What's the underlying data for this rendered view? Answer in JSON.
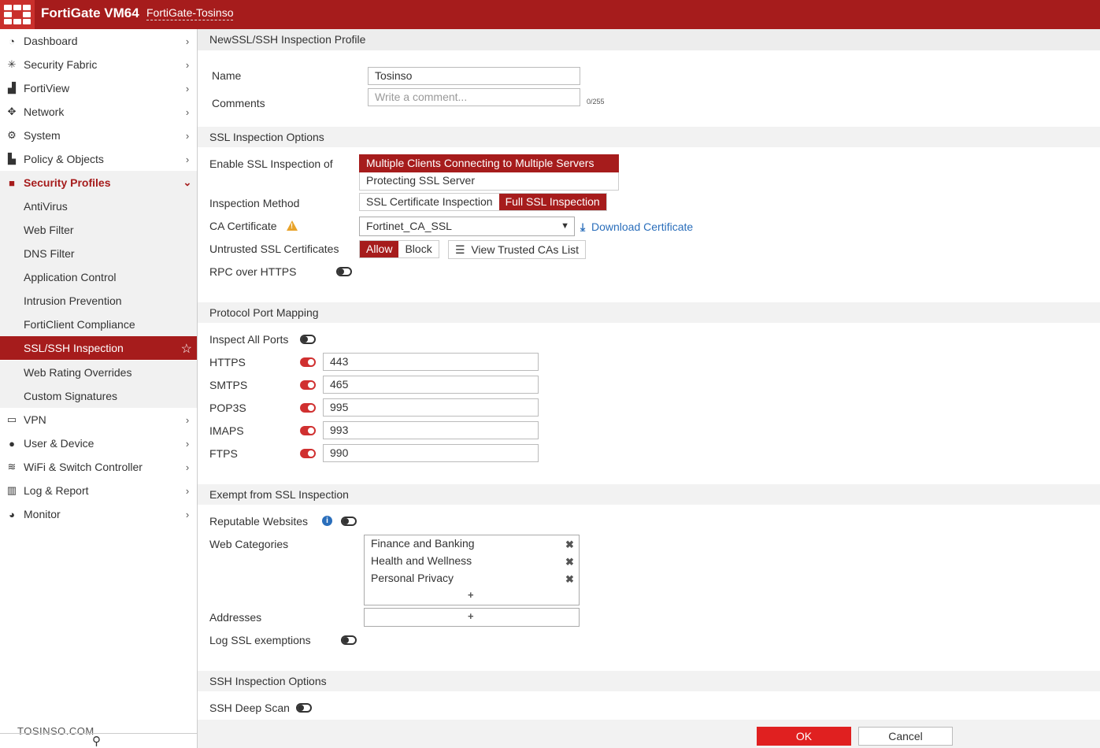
{
  "header": {
    "product": "FortiGate VM64",
    "hostname": "FortiGate-Tosinso"
  },
  "sidebar": {
    "items": [
      {
        "label": "Dashboard",
        "icon": "dashboard-icon",
        "glyph": "◔"
      },
      {
        "label": "Security Fabric",
        "icon": "security-fabric-icon",
        "glyph": "✳"
      },
      {
        "label": "FortiView",
        "icon": "fortiview-icon",
        "glyph": "▟"
      },
      {
        "label": "Network",
        "icon": "network-icon",
        "glyph": "✥"
      },
      {
        "label": "System",
        "icon": "gear-icon",
        "glyph": "⚙"
      },
      {
        "label": "Policy & Objects",
        "icon": "policy-icon",
        "glyph": "▙"
      },
      {
        "label": "Security Profiles",
        "icon": "lock-icon",
        "glyph": "🔒"
      }
    ],
    "security_profiles_sub": [
      "AntiVirus",
      "Web Filter",
      "DNS Filter",
      "Application Control",
      "Intrusion Prevention",
      "FortiClient Compliance",
      "SSL/SSH Inspection",
      "Web Rating Overrides",
      "Custom Signatures"
    ],
    "items_after": [
      {
        "label": "VPN",
        "icon": "laptop-icon",
        "glyph": "▭"
      },
      {
        "label": "User & Device",
        "icon": "user-icon",
        "glyph": "●"
      },
      {
        "label": "WiFi & Switch Controller",
        "icon": "wifi-icon",
        "glyph": "≋"
      },
      {
        "label": "Log & Report",
        "icon": "bar-chart-icon",
        "glyph": "▥"
      },
      {
        "label": "Monitor",
        "icon": "pie-chart-icon",
        "glyph": "◕"
      }
    ],
    "watermark": "TOSINSO.COM"
  },
  "main": {
    "title": "NewSSL/SSH Inspection Profile",
    "name_label": "Name",
    "name_value": "Tosinso",
    "comments_label": "Comments",
    "comments_placeholder": "Write a comment...",
    "comments_counter": "0/255",
    "ssl_section": "SSL Inspection Options",
    "enable_label": "Enable SSL Inspection of",
    "enable_options": [
      "Multiple Clients Connecting to Multiple Servers",
      "Protecting SSL Server"
    ],
    "method_label": "Inspection Method",
    "method_options": [
      "SSL Certificate Inspection",
      "Full SSL Inspection"
    ],
    "ca_label": "CA Certificate",
    "ca_value": "Fortinet_CA_SSL",
    "download_cert": "Download Certificate",
    "untrusted_label": "Untrusted SSL Certificates",
    "untrusted_options": [
      "Allow",
      "Block"
    ],
    "view_trusted": "View Trusted CAs List",
    "rpc_label": "RPC over HTTPS",
    "ppm_section": "Protocol Port Mapping",
    "inspect_all": "Inspect All Ports",
    "ports": [
      {
        "label": "HTTPS",
        "value": "443"
      },
      {
        "label": "SMTPS",
        "value": "465"
      },
      {
        "label": "POP3S",
        "value": "995"
      },
      {
        "label": "IMAPS",
        "value": "993"
      },
      {
        "label": "FTPS",
        "value": "990"
      }
    ],
    "exempt_section": "Exempt from SSL Inspection",
    "reputable_label": "Reputable Websites",
    "webcat_label": "Web Categories",
    "webcats": [
      "Finance and Banking",
      "Health and Wellness",
      "Personal Privacy"
    ],
    "addresses_label": "Addresses",
    "log_exempt_label": "Log SSL exemptions",
    "ssh_section": "SSH Inspection Options",
    "ssh_deep_label": "SSH Deep Scan",
    "ok": "OK",
    "cancel": "Cancel"
  },
  "colors": {
    "brand": "#a61c1c",
    "accent_on": "#d03030",
    "link": "#2a6ebb"
  }
}
